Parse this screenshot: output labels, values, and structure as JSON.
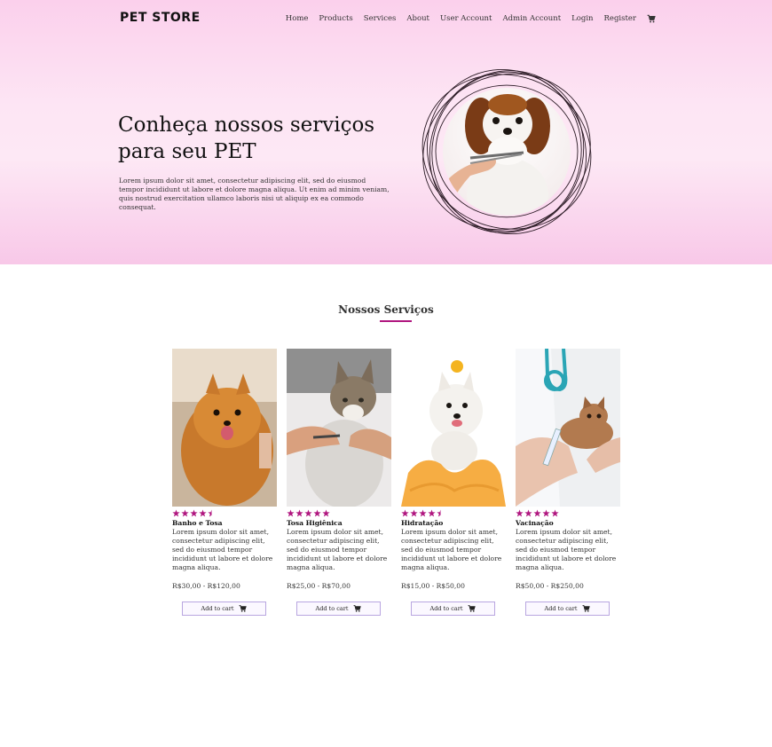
{
  "header": {
    "logo": "PET STORE",
    "nav": [
      "Home",
      "Products",
      "Services",
      "About",
      "User Account",
      "Admin Account",
      "Login",
      "Register"
    ]
  },
  "hero": {
    "title": "Conheça nossos serviços para seu PET",
    "text": "Lorem ipsum dolor sit amet, consectetur adipiscing elit, sed do eiusmod tempor incididunt ut labore et dolore magna aliqua. Ut enim ad minim veniam, quis nostrud exercitation ullamco laboris nisi ut aliquip ex ea commodo consequat."
  },
  "services": {
    "title": "Nossos Serviços",
    "items": [
      {
        "name": "Banho e Tosa",
        "rating": 4.5,
        "desc": "Lorem ipsum dolor sit amet, consectetur adipiscing elit, sed do eiusmod tempor incididunt ut labore et dolore magna aliqua.",
        "price": "R$30,00 - R$120,00",
        "button": "Add to cart"
      },
      {
        "name": "Tosa Higiênica",
        "rating": 5,
        "desc": "Lorem ipsum dolor sit amet, consectetur adipiscing elit, sed do eiusmod tempor incididunt ut labore et dolore magna aliqua.",
        "price": "R$25,00 - R$70,00",
        "button": "Add to cart"
      },
      {
        "name": "Hidratação",
        "rating": 4.5,
        "desc": "Lorem ipsum dolor sit amet, consectetur adipiscing elit, sed do eiusmod tempor incididunt ut labore et dolore magna aliqua.",
        "price": "R$15,00 - R$50,00",
        "button": "Add to cart"
      },
      {
        "name": "Vacinação",
        "rating": 5,
        "desc": "Lorem ipsum dolor sit amet, consectetur adipiscing elit, sed do eiusmod tempor incididunt ut labore et dolore magna aliqua.",
        "price": "R$50,00 - R$250,00",
        "button": "Add to cart"
      }
    ]
  },
  "colors": {
    "accent": "#b0167f",
    "hero_bg": "#fbd0ec"
  },
  "icons": [
    "cart-icon",
    "star-icon"
  ]
}
